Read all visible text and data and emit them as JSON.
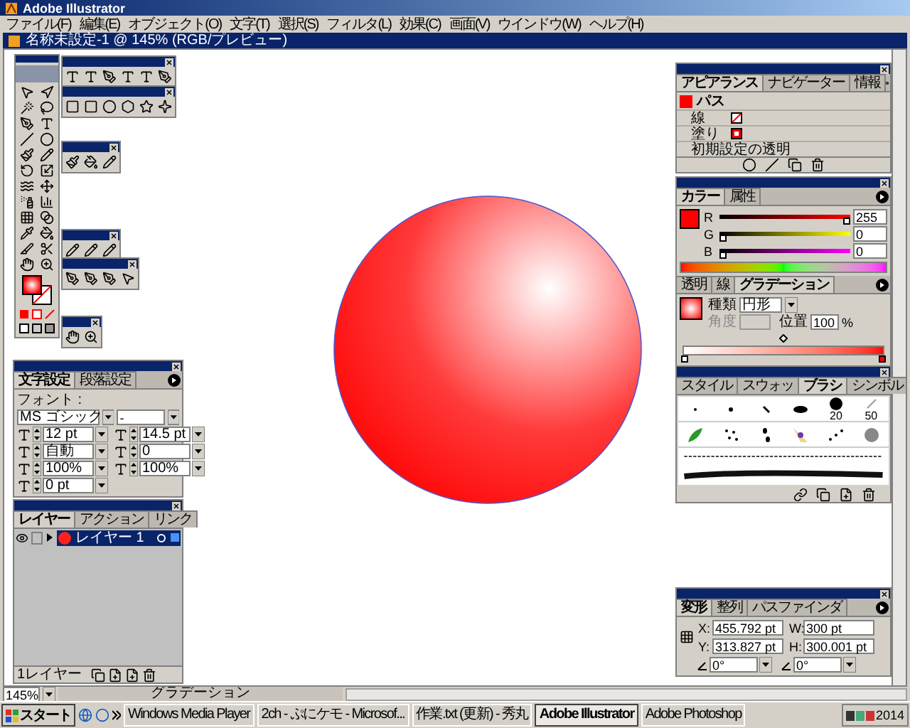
{
  "app_title": "Adobe Illustrator",
  "menu": [
    "ファイル(F)",
    "編集(E)",
    "オブジェクト(O)",
    "文字(T)",
    "選択(S)",
    "フィルタ(L)",
    "効果(C)",
    "画面(V)",
    "ウインドウ(W)",
    "ヘルプ(H)"
  ],
  "document": {
    "title": "名称未設定-1 @ 145% (RGB/プレビュー)"
  },
  "character_panel": {
    "tabs": [
      {
        "label": "文字設定",
        "selected": true
      },
      {
        "label": "段落設定",
        "selected": false
      }
    ],
    "font_label": "フォント :",
    "font": "MS ゴシック",
    "style": "-",
    "fields": [
      "12 pt",
      "14.5 pt",
      "自動",
      "0",
      "100%",
      "100%",
      "0 pt"
    ]
  },
  "layers_panel": {
    "tabs": [
      {
        "label": "レイヤー",
        "selected": true
      },
      {
        "label": "アクション",
        "selected": false
      },
      {
        "label": "リンク",
        "selected": false
      }
    ],
    "layers": [
      {
        "name": "レイヤー 1",
        "selected": true
      }
    ],
    "count": "1レイヤー"
  },
  "appearance_panel": {
    "tabs": [
      {
        "label": "アピアランス",
        "selected": true
      },
      {
        "label": "ナビゲーター",
        "selected": false
      },
      {
        "label": "情報",
        "selected": false
      }
    ],
    "object": "パス",
    "rows": [
      {
        "kind": "stroke",
        "label": "線"
      },
      {
        "kind": "fill",
        "label": "塗り"
      },
      {
        "kind": "text",
        "label": "初期設定の透明"
      }
    ]
  },
  "color_panel": {
    "tabs": [
      {
        "label": "カラー",
        "selected": true
      },
      {
        "label": "属性",
        "selected": false
      }
    ],
    "channels": [
      {
        "name": "R",
        "value": "255",
        "level": 1
      },
      {
        "name": "G",
        "value": "0",
        "level": 0
      },
      {
        "name": "B",
        "value": "0",
        "level": 0
      }
    ]
  },
  "gradient_panel": {
    "tabs": [
      {
        "label": "透明",
        "selected": false
      },
      {
        "label": "線",
        "selected": false
      },
      {
        "label": "グラデーション",
        "selected": true
      }
    ],
    "type_label": "種類",
    "type": "円形",
    "angle_label": "角度",
    "location_label": "位置",
    "location": "100",
    "percent": "%",
    "midpoint": {
      "level": 0.5
    }
  },
  "brushes_panel": {
    "tabs": [
      {
        "label": "スタイル",
        "selected": false
      },
      {
        "label": "スウォッ",
        "selected": false
      },
      {
        "label": "ブラシ",
        "selected": true
      },
      {
        "label": "シンボル",
        "selected": false
      }
    ],
    "sizes": [
      "20",
      "50"
    ]
  },
  "transform_panel": {
    "tabs": [
      {
        "label": "変形",
        "selected": true
      },
      {
        "label": "整列",
        "selected": false
      },
      {
        "label": "パスファインダ",
        "selected": false
      }
    ],
    "fields": [
      {
        "label": "X:",
        "value": "455.792 pt"
      },
      {
        "label": "W:",
        "value": "300 pt"
      },
      {
        "label": "Y:",
        "value": "313.827 pt"
      },
      {
        "label": "H:",
        "value": "300.001 pt"
      }
    ],
    "angles": [
      "0°",
      "0°"
    ]
  },
  "status_bar": {
    "zoom": "145%",
    "info": "グラデーション"
  },
  "taskbar": {
    "start": "スタート",
    "tasks": [
      {
        "label": "Windows Media Player",
        "selected": false
      },
      {
        "label": "2ch - ぷにケモ - Microsof...",
        "selected": false
      },
      {
        "label": "作業.txt (更新) - 秀丸",
        "selected": false
      },
      {
        "label": "Adobe Illustrator",
        "selected": true
      },
      {
        "label": "Adobe Photoshop",
        "selected": false
      }
    ],
    "clock": "2014"
  }
}
